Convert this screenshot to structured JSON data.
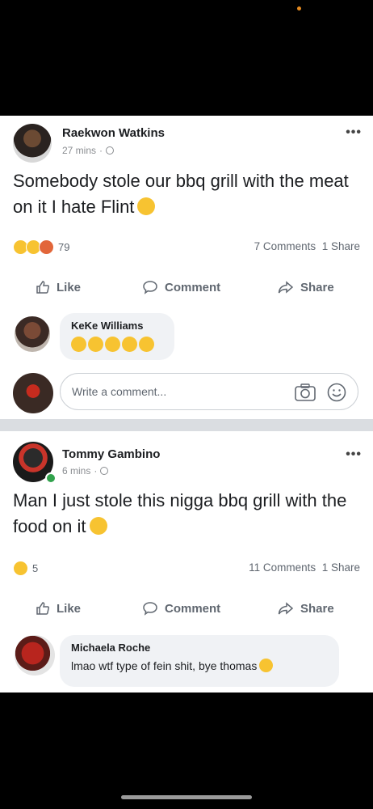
{
  "post1": {
    "author": "Raekwon Watkins",
    "time": "27 mins",
    "text": "Somebody stole our bbq grill with the meat on it I hate Flint",
    "reaction_count": "79",
    "comments": "7 Comments",
    "shares": "1 Share",
    "actions": {
      "like": "Like",
      "comment": "Comment",
      "share": "Share"
    },
    "reply": {
      "author": "KeKe Williams"
    },
    "write_placeholder": "Write a comment..."
  },
  "post2": {
    "author": "Tommy Gambino",
    "time": "6 mins",
    "text": "Man I just stole this nigga bbq grill with the food on it",
    "reaction_count": "5",
    "comments": "11 Comments",
    "shares": "1 Share",
    "actions": {
      "like": "Like",
      "comment": "Comment",
      "share": "Share"
    },
    "reply": {
      "author": "Michaela Roche",
      "text": "lmao wtf type of fein shit, bye thomas"
    }
  },
  "icons": [
    "more-icon",
    "globe-icon",
    "like-icon",
    "comment-icon",
    "share-icon",
    "camera-icon",
    "smile-icon",
    "emoji-icon"
  ],
  "colors": {
    "text": "#1c1e21",
    "meta": "#606770",
    "bubble": "#f0f2f5",
    "emoji": "#f7c331"
  }
}
